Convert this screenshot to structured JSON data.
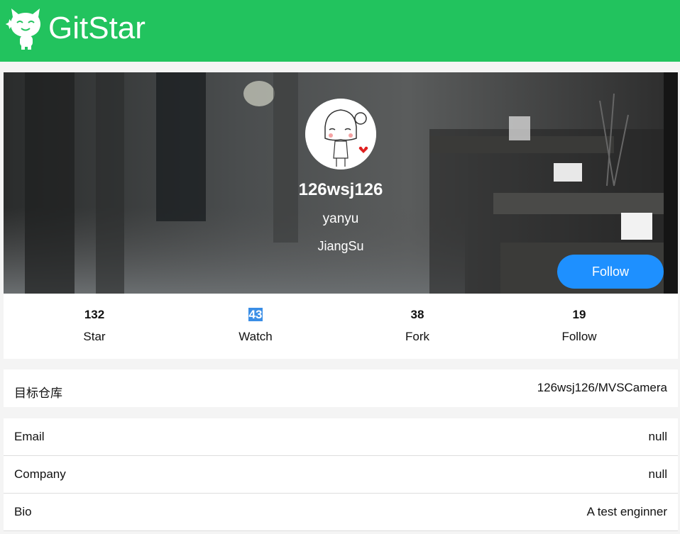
{
  "header": {
    "brand": "GitStar",
    "logo_icon": "cat-logo-icon",
    "color": "#22c35e"
  },
  "profile": {
    "username": "126wsj126",
    "name": "yanyu",
    "location": "JiangSu",
    "follow_label": "Follow"
  },
  "stats": [
    {
      "value": "132",
      "label": "Star"
    },
    {
      "value": "43",
      "label": "Watch"
    },
    {
      "value": "38",
      "label": "Fork"
    },
    {
      "value": "19",
      "label": "Follow"
    }
  ],
  "target": {
    "label": "目标仓库",
    "value": "126wsj126/MVSCamera"
  },
  "details": [
    {
      "label": "Email",
      "value": "null"
    },
    {
      "label": "Company",
      "value": "null"
    },
    {
      "label": "Bio",
      "value": "A test enginner"
    }
  ],
  "colors": {
    "accent": "#1e90ff",
    "highlight": "#3a8ee6"
  }
}
